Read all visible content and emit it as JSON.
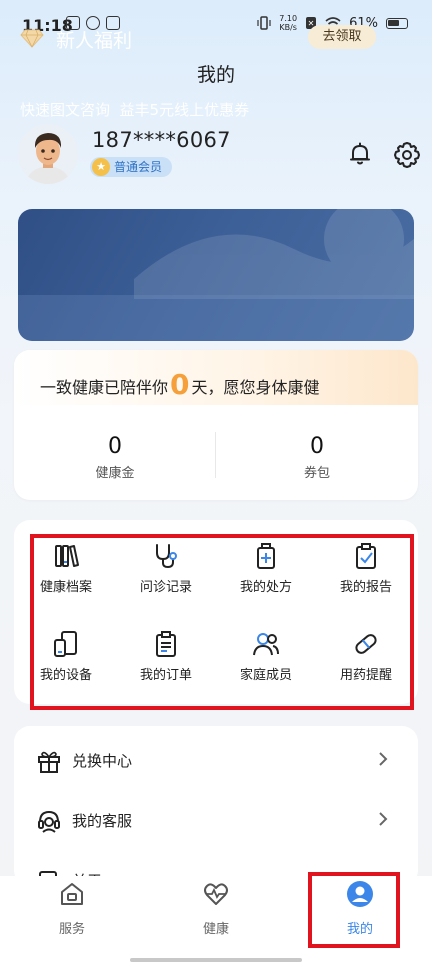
{
  "status_bar": {
    "time": "11:18",
    "net_speed_value": "7.10",
    "net_speed_unit": "KB/s",
    "battery": "61%"
  },
  "header": {
    "title": "我的"
  },
  "profile": {
    "phone": "187****6067",
    "member_badge": "普通会员"
  },
  "welfare": {
    "title": "新人福利",
    "claim_label": "去领取",
    "description": "快速图文咨询  益丰5元线上优惠券"
  },
  "companion": {
    "text_before": "一致健康已陪伴你",
    "days": "0",
    "text_after": "天，愿您身体康健"
  },
  "stats": [
    {
      "value": "0",
      "label": "健康金"
    },
    {
      "value": "0",
      "label": "券包"
    }
  ],
  "grid": [
    {
      "label": "健康档案",
      "icon": "health-record-icon"
    },
    {
      "label": "问诊记录",
      "icon": "stethoscope-icon"
    },
    {
      "label": "我的处方",
      "icon": "prescription-icon"
    },
    {
      "label": "我的报告",
      "icon": "report-icon"
    },
    {
      "label": "我的设备",
      "icon": "device-icon"
    },
    {
      "label": "我的订单",
      "icon": "order-icon"
    },
    {
      "label": "家庭成员",
      "icon": "family-icon"
    },
    {
      "label": "用药提醒",
      "icon": "pill-icon"
    }
  ],
  "menu": [
    {
      "label": "兑换中心",
      "icon": "gift-icon"
    },
    {
      "label": "我的客服",
      "icon": "customer-service-icon"
    },
    {
      "label": "关于",
      "icon": "about-icon"
    }
  ],
  "bottom_nav": [
    {
      "label": "服务",
      "icon": "home-icon",
      "active": false
    },
    {
      "label": "健康",
      "icon": "heart-pulse-icon",
      "active": false
    },
    {
      "label": "我的",
      "icon": "profile-icon",
      "active": true
    }
  ],
  "colors": {
    "accent": "#3b86e8",
    "welfare_bg": "#3c5f97",
    "days_highlight": "#f5a03a",
    "annotation_box": "#e0141e"
  }
}
